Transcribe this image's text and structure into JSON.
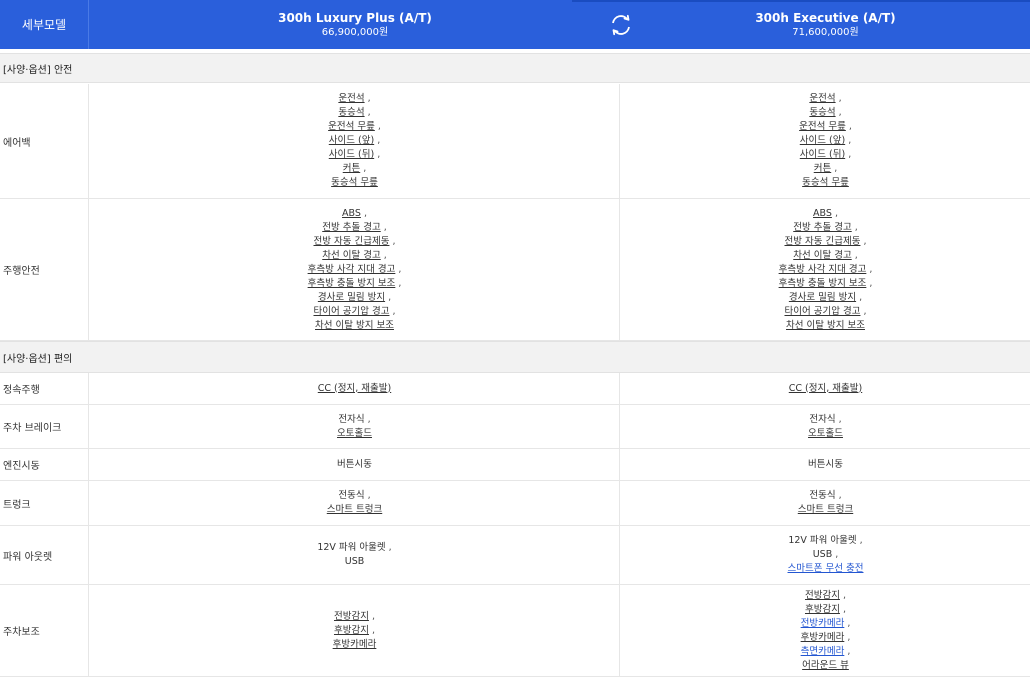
{
  "header": {
    "label": "세부모델",
    "col1": {
      "name": "300h Luxury Plus (A/T)",
      "price": "66,900,000원"
    },
    "col2": {
      "name": "300h Executive (A/T)",
      "price": "71,600,000원"
    },
    "swap_icon": "swap-icon"
  },
  "sections": {
    "safety": "[사양·옵션] 안전",
    "convenience": "[사양·옵션] 편의"
  },
  "rows": [
    {
      "label": "에어백",
      "col1": [
        {
          "text": "운전석",
          "style": "link"
        },
        {
          "text": "동승석",
          "style": "link"
        },
        {
          "text": "운전석 무릎",
          "style": "link"
        },
        {
          "text": "사이드 (앞)",
          "style": "link"
        },
        {
          "text": "사이드 (뒤)",
          "style": "link"
        },
        {
          "text": "커튼",
          "style": "link"
        },
        {
          "text": "동승석 무릎",
          "style": "link"
        }
      ],
      "col2": [
        {
          "text": "운전석",
          "style": "link"
        },
        {
          "text": "동승석",
          "style": "link"
        },
        {
          "text": "운전석 무릎",
          "style": "link"
        },
        {
          "text": "사이드 (앞)",
          "style": "link"
        },
        {
          "text": "사이드 (뒤)",
          "style": "link"
        },
        {
          "text": "커튼",
          "style": "link"
        },
        {
          "text": "동승석 무릎",
          "style": "link"
        }
      ]
    },
    {
      "label": "주행안전",
      "col1": [
        {
          "text": "ABS",
          "style": "link"
        },
        {
          "text": "전방 추돌 경고",
          "style": "link"
        },
        {
          "text": "전방 자동 긴급제동",
          "style": "link"
        },
        {
          "text": "차선 이탈 경고",
          "style": "link"
        },
        {
          "text": "후측방 사각 지대 경고",
          "style": "link"
        },
        {
          "text": "후측방 충돌 방지 보조",
          "style": "link"
        },
        {
          "text": "경사로 밀림 방지",
          "style": "link"
        },
        {
          "text": "타이어 공기압 경고",
          "style": "link"
        },
        {
          "text": "차선 이탈 방지 보조",
          "style": "link"
        }
      ],
      "col2": [
        {
          "text": "ABS",
          "style": "link"
        },
        {
          "text": "전방 추돌 경고",
          "style": "link"
        },
        {
          "text": "전방 자동 긴급제동",
          "style": "link"
        },
        {
          "text": "차선 이탈 경고",
          "style": "link"
        },
        {
          "text": "후측방 사각 지대 경고",
          "style": "link"
        },
        {
          "text": "후측방 충돌 방지 보조",
          "style": "link"
        },
        {
          "text": "경사로 밀림 방지",
          "style": "link"
        },
        {
          "text": "타이어 공기압 경고",
          "style": "link"
        },
        {
          "text": "차선 이탈 방지 보조",
          "style": "link"
        }
      ]
    },
    {
      "label": "정속주행",
      "col1": [
        {
          "text": "CC (정지, 재출발)",
          "style": "link"
        }
      ],
      "col2": [
        {
          "text": "CC (정지, 재출발)",
          "style": "link"
        }
      ]
    },
    {
      "label": "주차 브레이크",
      "col1": [
        {
          "text": "전자식",
          "style": "plain"
        },
        {
          "text": "오토홀드",
          "style": "link"
        }
      ],
      "col2": [
        {
          "text": "전자식",
          "style": "plain"
        },
        {
          "text": "오토홀드",
          "style": "link"
        }
      ]
    },
    {
      "label": "엔진시동",
      "col1": [
        {
          "text": "버튼시동",
          "style": "plain"
        }
      ],
      "col2": [
        {
          "text": "버튼시동",
          "style": "plain"
        }
      ]
    },
    {
      "label": "트렁크",
      "col1": [
        {
          "text": "전동식",
          "style": "plain"
        },
        {
          "text": "스마트 트렁크",
          "style": "link"
        }
      ],
      "col2": [
        {
          "text": "전동식",
          "style": "plain"
        },
        {
          "text": "스마트 트렁크",
          "style": "link"
        }
      ]
    },
    {
      "label": "파워 아웃렛",
      "col1": [
        {
          "text": "12V 파워 아울렛",
          "style": "plain"
        },
        {
          "text": "USB",
          "style": "plain"
        }
      ],
      "col2": [
        {
          "text": "12V 파워 아울렛",
          "style": "plain"
        },
        {
          "text": "USB",
          "style": "plain"
        },
        {
          "text": "스마트폰 무선 충전",
          "style": "blue"
        }
      ]
    },
    {
      "label": "주차보조",
      "col1": [
        {
          "text": "전방감지",
          "style": "link"
        },
        {
          "text": "후방감지",
          "style": "link"
        },
        {
          "text": "후방카메라",
          "style": "link"
        }
      ],
      "col2": [
        {
          "text": "전방감지",
          "style": "link"
        },
        {
          "text": "후방감지",
          "style": "link"
        },
        {
          "text": "전방카메라",
          "style": "blue"
        },
        {
          "text": "후방카메라",
          "style": "link"
        },
        {
          "text": "측면카메라",
          "style": "blue"
        },
        {
          "text": "어라운드 뷰",
          "style": "link"
        }
      ]
    }
  ]
}
